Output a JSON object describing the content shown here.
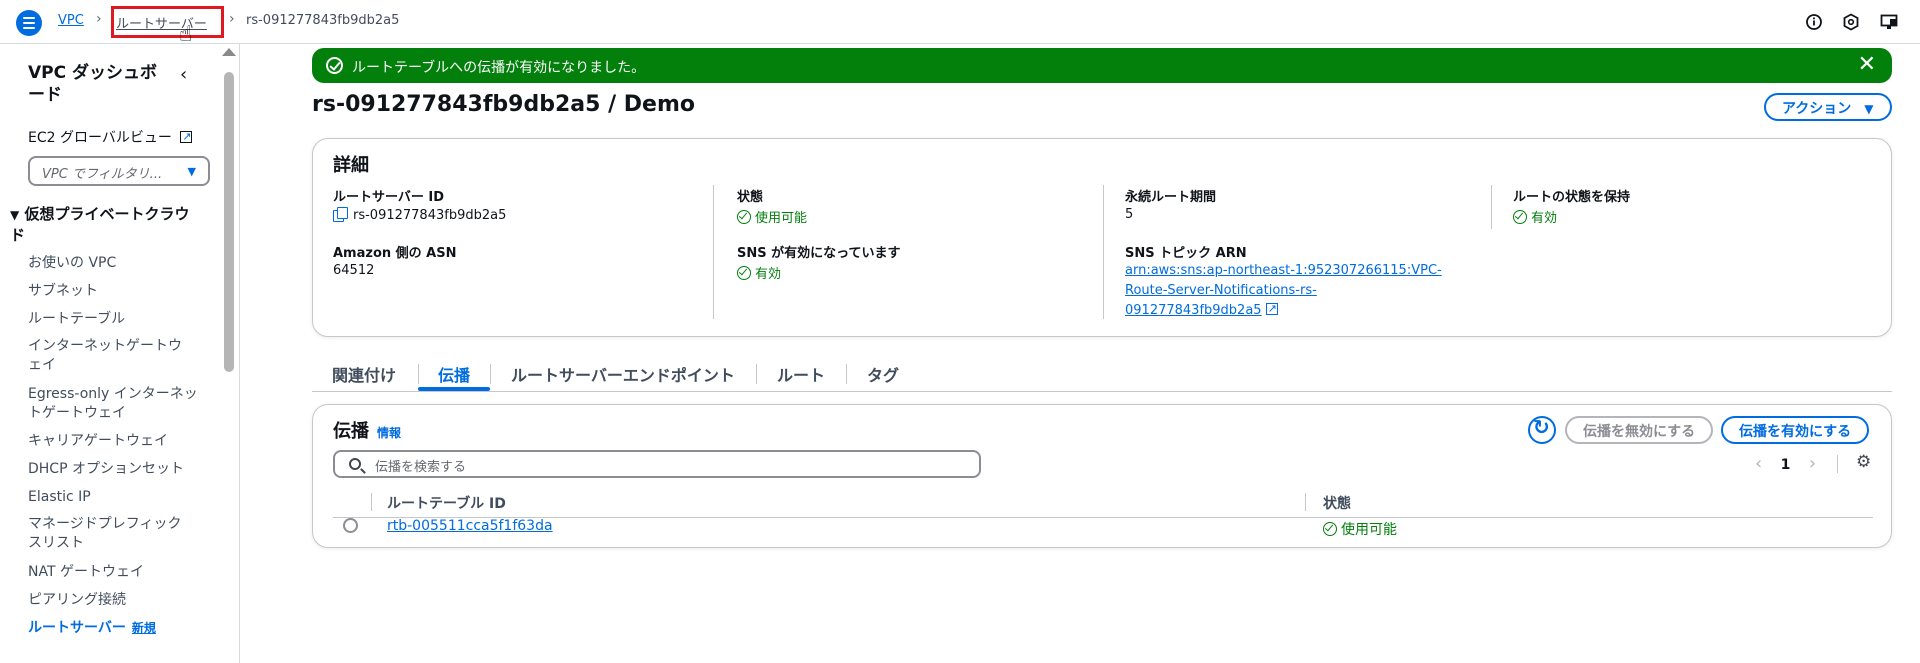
{
  "breadcrumb": {
    "home": "VPC",
    "parent": "ルートサーバー",
    "current": "rs-091277843fb9db2a5"
  },
  "icons": {
    "menu": "hamburger-icon",
    "info": "info-icon",
    "notifications": "notifications-icon",
    "settings": "settings-icon"
  },
  "sidebar": {
    "title": "VPC ダッシュボード",
    "global_view": "EC2 グローバルビュー",
    "filter_placeholder": "VPC でフィルタリ...",
    "section": "仮想プライベートクラウド",
    "items": [
      "お使いの VPC",
      "サブネット",
      "ルートテーブル",
      "インターネットゲートウェイ",
      "Egress-only インターネットゲートウェイ",
      "キャリアゲートウェイ",
      "DHCP オプションセット",
      "Elastic IP",
      "マネージドプレフィックスリスト",
      "NAT ゲートウェイ",
      "ピアリング接続"
    ],
    "active_item": "ルートサーバー",
    "active_badge": "新規"
  },
  "flash": {
    "message": "ルートテーブルへの伝播が有効になりました。",
    "color": "#037f0c"
  },
  "page": {
    "title": "rs-091277843fb9db2a5 / Demo",
    "actions_label": "アクション"
  },
  "details": {
    "title": "詳細",
    "route_server_id_label": "ルートサーバー ID",
    "route_server_id": "rs-091277843fb9db2a5",
    "state_label": "状態",
    "state_value": "使用可能",
    "persist_label": "永続ルート期間",
    "persist_value": "5",
    "keep_state_label": "ルートの状態を保持",
    "keep_state_value": "有効",
    "asn_label": "Amazon 側の ASN",
    "asn_value": "64512",
    "sns_label": "SNS が有効になっています",
    "sns_value": "有効",
    "sns_arn_label": "SNS トピック ARN",
    "sns_arn_line1": "arn:aws:sns:ap-northeast-1:952307266115:VPC-",
    "sns_arn_line2": "Route-Server-Notifications-rs-",
    "sns_arn_line3": "091277843fb9db2a5"
  },
  "tabs": [
    "関連付け",
    "伝播",
    "ルートサーバーエンドポイント",
    "ルート",
    "タグ"
  ],
  "propagation": {
    "title": "伝播",
    "info": "情報",
    "disable_label": "伝播を無効にする",
    "enable_label": "伝播を有効にする",
    "search_placeholder": "伝播を検索する",
    "page_number": "1",
    "columns": [
      "ルートテーブル ID",
      "状態"
    ],
    "rows": [
      {
        "route_table_id": "rtb-005511cca5f1f63da",
        "state": "使用可能"
      }
    ]
  },
  "colors": {
    "accent": "#006ce0",
    "success": "#037f0c",
    "highlight": "#e0181f"
  }
}
